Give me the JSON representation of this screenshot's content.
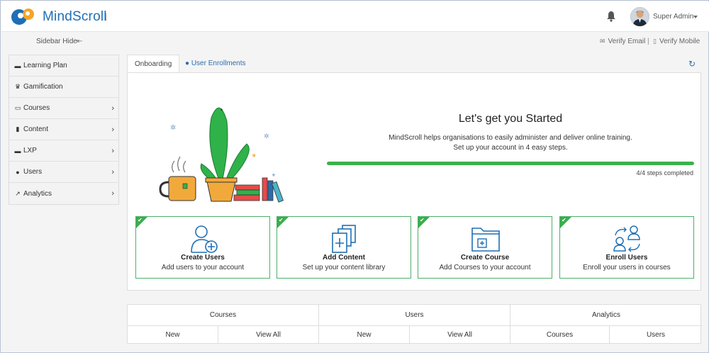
{
  "app": {
    "name": "MindScroll",
    "separator": "|"
  },
  "header": {
    "user_name": "Super Admin"
  },
  "subbar": {
    "sidebar_hide": "Sidebar Hide",
    "sidebar_hide_icon": "⇤",
    "verify_email": "Verify Email",
    "verify_mobile": "Verify Mobile",
    "separator": "|"
  },
  "sidebar": {
    "items": [
      {
        "label": "Learning Plan",
        "icon": "book-icon",
        "glyph": "▬"
      },
      {
        "label": "Gamification",
        "icon": "trophy-icon",
        "glyph": "♛"
      },
      {
        "label": "Courses",
        "icon": "courses-icon",
        "glyph": "▭"
      },
      {
        "label": "Content",
        "icon": "file-icon",
        "glyph": "▮"
      },
      {
        "label": "LXP",
        "icon": "book-icon",
        "glyph": "▬"
      },
      {
        "label": "Users",
        "icon": "users-icon",
        "glyph": "●"
      },
      {
        "label": "Analytics",
        "icon": "chart-icon",
        "glyph": "↗"
      }
    ],
    "chevron": "›"
  },
  "tabs": {
    "onboarding": "Onboarding",
    "user_enrollments": "User Enrollments",
    "refresh_icon": "↻"
  },
  "onboarding": {
    "title": "Let's get you Started",
    "desc_line1": "MindScroll helps organisations to easily administer and deliver online training.",
    "desc_line2": "Set up your account in 4 easy steps.",
    "progress_fraction": 1.0,
    "steps_text": "4/4 steps completed"
  },
  "cards": [
    {
      "title": "Create Users",
      "subtitle": "Add users to your account",
      "icon": "add-user-icon"
    },
    {
      "title": "Add Content",
      "subtitle": "Set up your content library",
      "icon": "add-content-icon"
    },
    {
      "title": "Create Course",
      "subtitle": "Add Courses to your account",
      "icon": "create-course-icon"
    },
    {
      "title": "Enroll Users",
      "subtitle": "Enroll your users in courses",
      "icon": "enroll-users-icon"
    }
  ],
  "bottom": {
    "headers": [
      "Courses",
      "Users",
      "Analytics"
    ],
    "courses": [
      "New",
      "View All"
    ],
    "users": [
      "New",
      "View All"
    ],
    "analytics": [
      "Courses",
      "Users"
    ]
  },
  "colors": {
    "brand": "#1e6fb5",
    "success": "#3bb24b",
    "card_border": "#4caf6a",
    "link": "#2a6db0"
  }
}
